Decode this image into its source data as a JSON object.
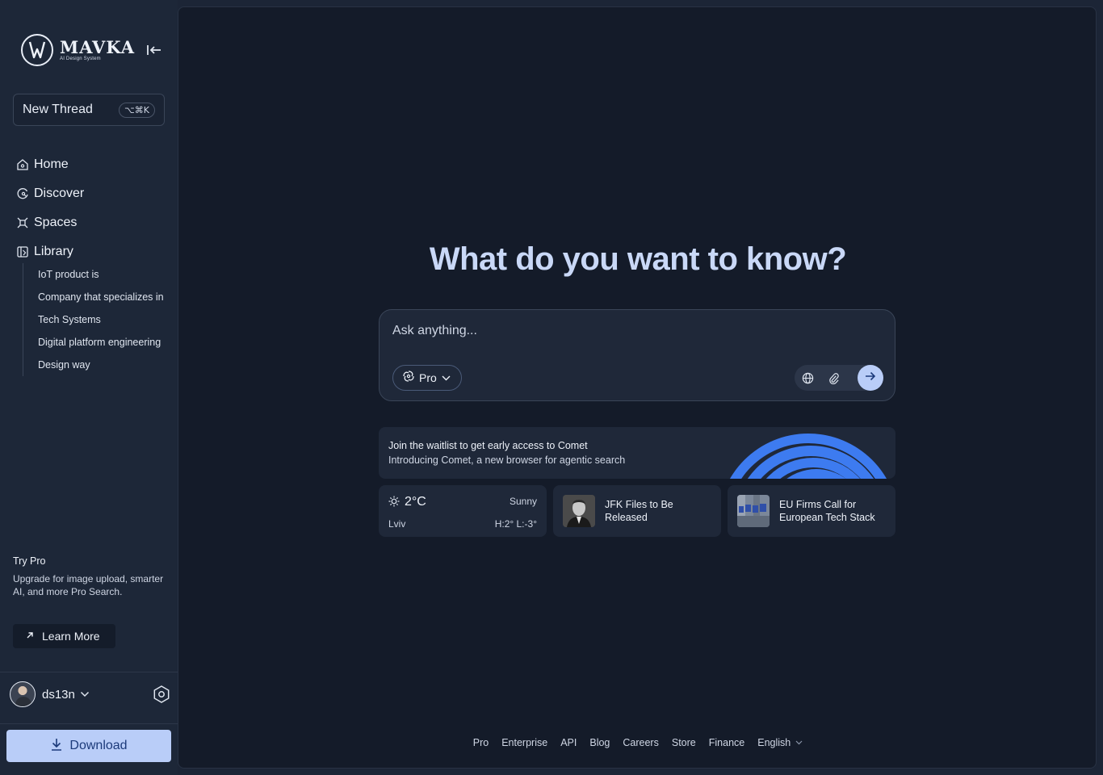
{
  "brand": {
    "name": "MAVKA",
    "tagline": "AI Design System"
  },
  "sidebar": {
    "new_thread": {
      "label": "New Thread",
      "shortcut": "⌥⌘K"
    },
    "nav": [
      {
        "label": "Home",
        "icon": "home-icon"
      },
      {
        "label": "Discover",
        "icon": "compass-icon"
      },
      {
        "label": "Spaces",
        "icon": "spaces-icon"
      },
      {
        "label": "Library",
        "icon": "library-icon"
      }
    ],
    "library_items": [
      "IoT product is",
      "Company that specializes in",
      "Tech Systems",
      "Digital platform engineering",
      "Design way"
    ],
    "try_pro": {
      "title": "Try Pro",
      "description": "Upgrade for image upload, smarter AI, and more Pro Search.",
      "button": "Learn More"
    },
    "user": {
      "name": "ds13n"
    },
    "download": "Download"
  },
  "main": {
    "headline": "What do you want to know?",
    "search": {
      "placeholder": "Ask anything...",
      "mode": "Pro"
    },
    "banner": {
      "title": "Join the waitlist to get early access to Comet",
      "subtitle": "Introducing Comet, a new browser for agentic search"
    },
    "weather": {
      "temp": "2°C",
      "condition": "Sunny",
      "city": "Lviv",
      "high_low": "H:2° L:-3°"
    },
    "news": [
      {
        "title": "JFK Files to Be Released"
      },
      {
        "title": "EU Firms Call for European Tech Stack"
      }
    ],
    "footer": [
      "Pro",
      "Enterprise",
      "API",
      "Blog",
      "Careers",
      "Store",
      "Finance",
      "English"
    ]
  },
  "colors": {
    "accent": "#b9cdf8",
    "background": "#141b29",
    "sidebar": "#1d2738",
    "card": "#1f2839",
    "comet_blue": "#3d7bf0"
  }
}
